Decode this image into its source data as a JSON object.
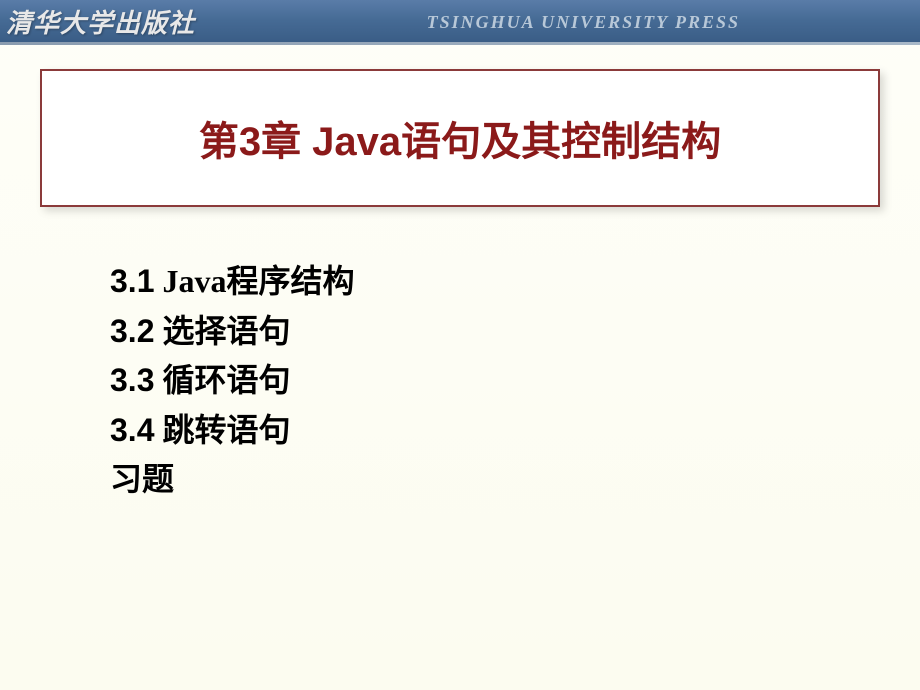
{
  "header": {
    "publisher_cn": "清华大学出版社",
    "publisher_en": "TSINGHUA UNIVERSITY PRESS"
  },
  "title": "第3章  Java语句及其控制结构",
  "toc": {
    "items": [
      {
        "number": "3.1",
        "text": "Java程序结构"
      },
      {
        "number": "3.2",
        "text": "选择语句"
      },
      {
        "number": "3.3",
        "text": "循环语句"
      },
      {
        "number": "3.4",
        "text": "跳转语句"
      },
      {
        "number": "",
        "text": "习题"
      }
    ]
  }
}
